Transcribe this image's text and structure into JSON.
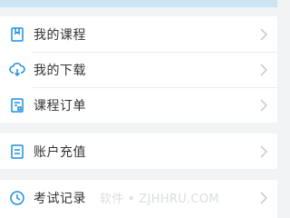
{
  "menu": {
    "group1": [
      {
        "label": "我的课程",
        "icon": "bookmark-book-icon"
      },
      {
        "label": "我的下载",
        "icon": "cloud-download-icon"
      },
      {
        "label": "课程订单",
        "icon": "order-receipt-icon"
      }
    ],
    "group2": [
      {
        "label": "账户充值",
        "icon": "wallet-card-icon"
      }
    ],
    "group3": [
      {
        "label": "考试记录",
        "icon": "clock-icon"
      }
    ]
  },
  "watermark": "软件 • ZJHHRU.COM",
  "colors": {
    "accent": "#1a8fe0",
    "background": "#f2f3f5",
    "text": "#333333",
    "chevron": "#c8c8c8"
  }
}
